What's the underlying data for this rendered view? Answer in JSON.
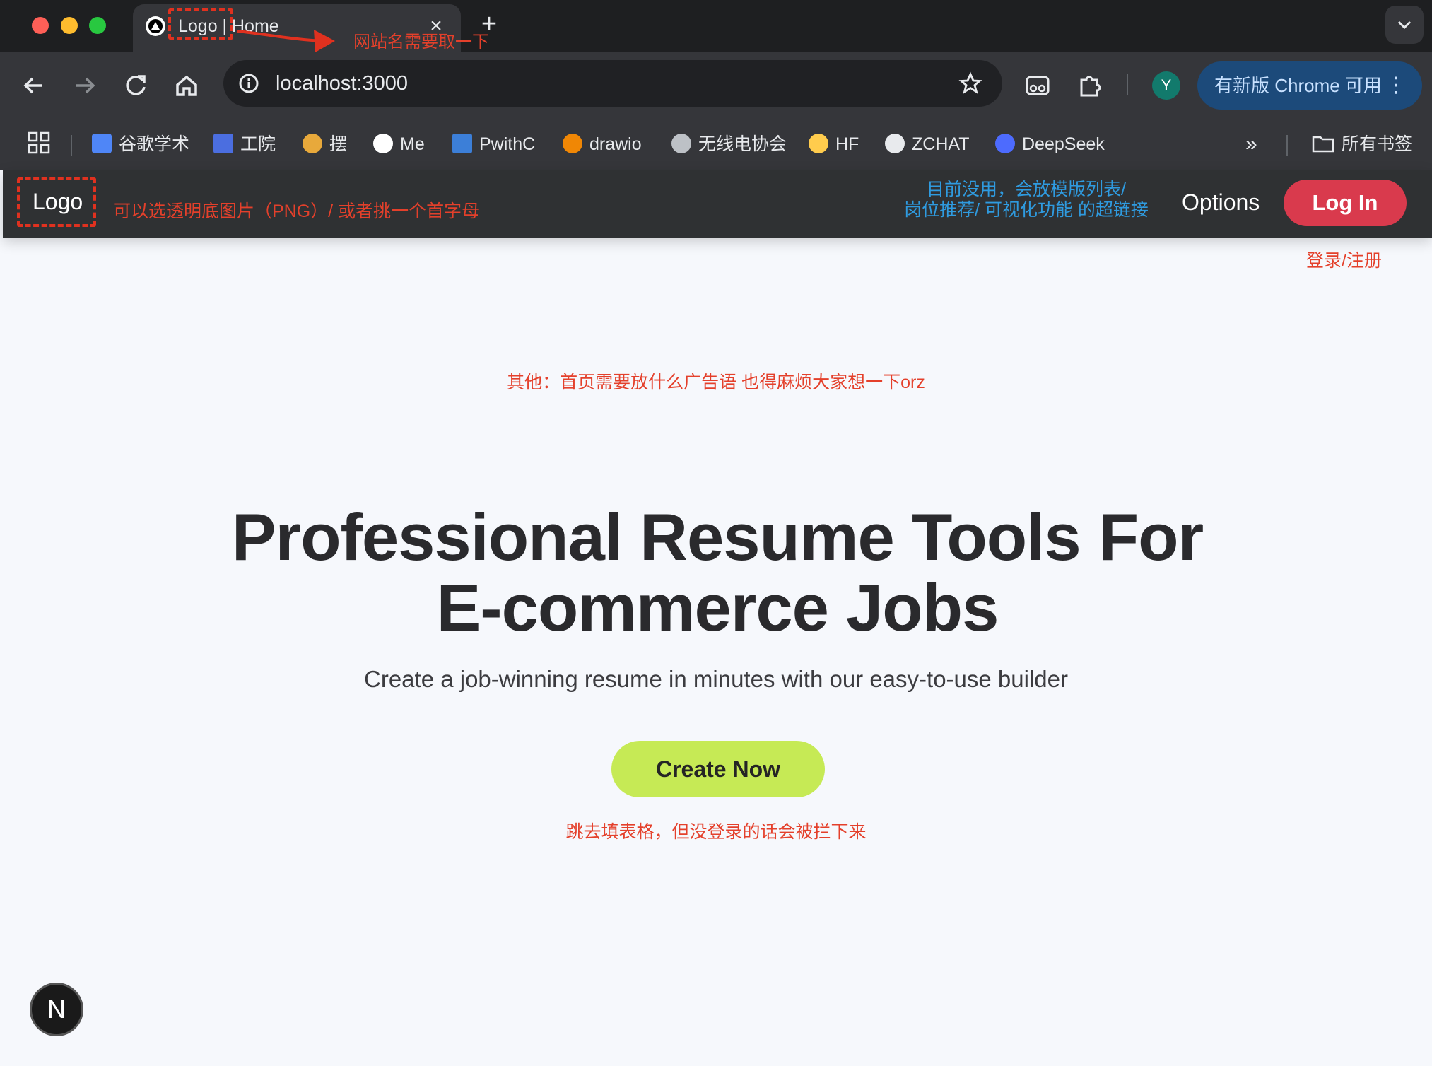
{
  "browser": {
    "tab_title": "Logo | Home",
    "tab_close": "×",
    "new_tab": "+",
    "url": "localhost:3000",
    "profile_initial": "Y",
    "update_label": "有新版 Chrome 可用",
    "update_menu": "⋮",
    "bookmarks": [
      {
        "label": "谷歌学术",
        "color": "#4f86f7"
      },
      {
        "label": "工院",
        "color": "#4b6ee0"
      },
      {
        "label": "摆",
        "color": "#e8a93b"
      },
      {
        "label": "Me",
        "color": "#ffffff"
      },
      {
        "label": "PwithC",
        "color": "#3c7fd8"
      },
      {
        "label": "drawio",
        "color": "#f08705"
      },
      {
        "label": "无线电协会",
        "color": "#bdc1c6"
      },
      {
        "label": "HF",
        "color": "#ffcc4d"
      },
      {
        "label": "ZCHAT",
        "color": "#e8eaed"
      },
      {
        "label": "DeepSeek",
        "color": "#4d6bfe"
      }
    ],
    "bookmarks_overflow": "»",
    "all_bookmarks": "所有书签"
  },
  "header": {
    "logo": "Logo",
    "options": "Options",
    "login": "Log In"
  },
  "hero": {
    "title": "Professional Resume Tools For E-commerce Jobs",
    "subtitle": "Create a job-winning resume in minutes with our easy-to-use builder",
    "cta": "Create Now"
  },
  "badge": "N",
  "annotations": {
    "site_name": "网站名需要取一下",
    "logo_note": "可以选透明底图片（PNG）/ 或者挑一个首字母",
    "options_note_line1": "目前没用，会放模版列表/",
    "options_note_line2": "岗位推荐/ 可视化功能 的超链接",
    "login_note": "登录/注册",
    "slogan_note": "其他：首页需要放什么广告语 也得麻烦大家想一下orz",
    "cta_note": "跳去填表格，但没登录的话会被拦下来"
  },
  "colors": {
    "header_bg": "#2f3133",
    "login_button": "#d93a4d",
    "cta_button": "#c6ea55",
    "annotation_red": "#e4402b",
    "annotation_blue": "#2f9be0"
  }
}
